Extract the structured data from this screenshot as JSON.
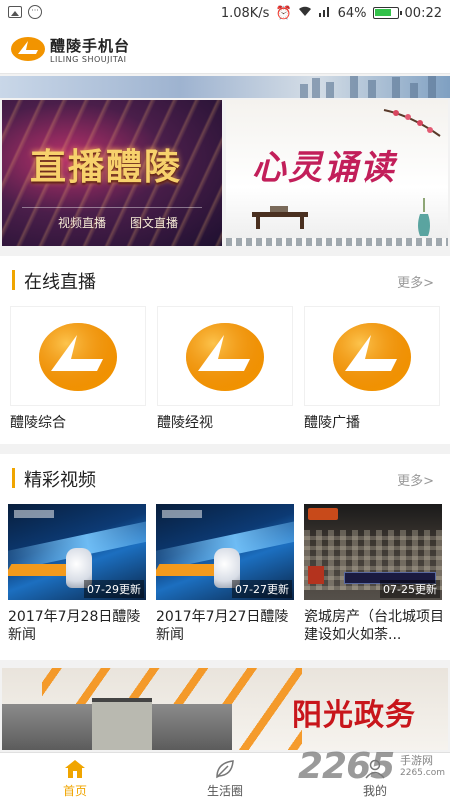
{
  "status_bar": {
    "speed": "1.08K/s",
    "battery": "64%",
    "time": "00:22"
  },
  "app": {
    "title": "醴陵手机台",
    "subtitle": "LILING SHOUJITAI"
  },
  "promos": {
    "live": {
      "headline": "直播醴陵",
      "sub_left": "视频直播",
      "sub_right": "图文直播"
    },
    "reading": {
      "headline": "心灵诵读"
    }
  },
  "live_section": {
    "title": "在线直播",
    "more": "更多>",
    "channels": [
      {
        "name": "醴陵综合"
      },
      {
        "name": "醴陵经视"
      },
      {
        "name": "醴陵广播"
      }
    ]
  },
  "video_section": {
    "title": "精彩视频",
    "more": "更多>",
    "videos": [
      {
        "badge": "07-29更新",
        "title": "2017年7月28日醴陵新闻"
      },
      {
        "badge": "07-27更新",
        "title": "2017年7月27日醴陵新闻"
      },
      {
        "badge": "07-25更新",
        "title": "瓷城房产（台北城项目建设如火如荼..."
      }
    ]
  },
  "bottom_banner": {
    "text": "阳光政务"
  },
  "tabs": [
    {
      "label": "首页",
      "icon": "home-icon",
      "active": true
    },
    {
      "label": "生活圈",
      "icon": "leaf-icon",
      "active": false
    },
    {
      "label": "我的",
      "icon": "user-icon",
      "active": false
    }
  ],
  "watermark": {
    "number": "2265",
    "sub": "手游网",
    "url": "2265.com"
  },
  "colors": {
    "accent": "#f0a500",
    "brand_orange": "#f29400"
  }
}
